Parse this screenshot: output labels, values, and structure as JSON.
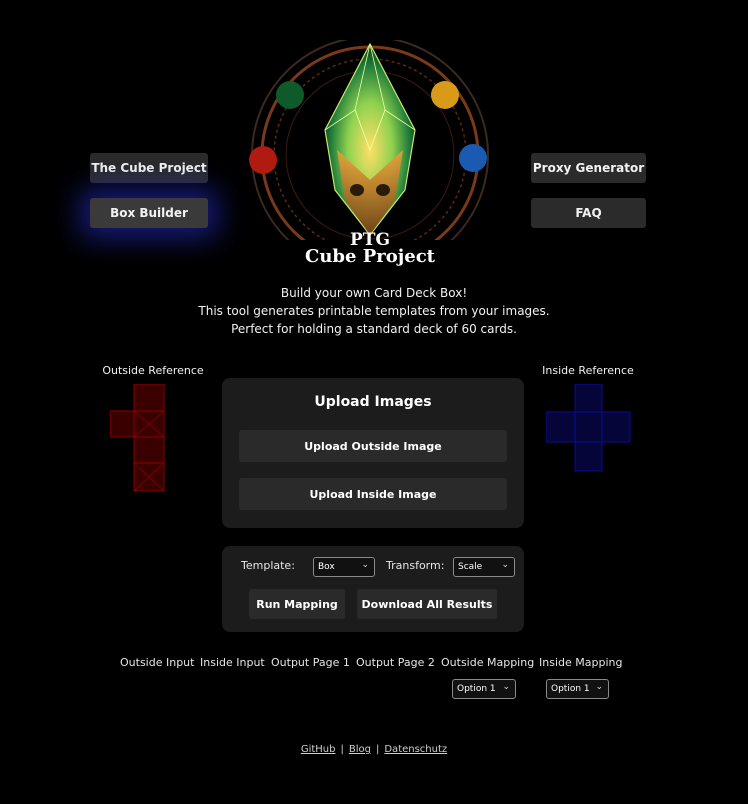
{
  "nav": {
    "cube_project": "The Cube Project",
    "box_builder": "Box Builder",
    "proxy_generator": "Proxy Generator",
    "faq": "FAQ"
  },
  "logo": {
    "line1": "PTG",
    "line2": "Cube Project"
  },
  "intro": {
    "line1": "Build your own Card Deck Box!",
    "line2": "This tool generates printable templates from your images.",
    "line3": "Perfect for holding a standard deck of 60 cards."
  },
  "references": {
    "outside_label": "Outside Reference",
    "inside_label": "Inside Reference",
    "outside_color": "#8b0000",
    "inside_color": "#0a0a9a"
  },
  "upload": {
    "title": "Upload Images",
    "outside_button": "Upload Outside Image",
    "inside_button": "Upload Inside Image"
  },
  "controls": {
    "template_label": "Template:",
    "template_value": "Box",
    "transform_label": "Transform:",
    "transform_value": "Scale",
    "run_button": "Run Mapping",
    "download_button": "Download All Results"
  },
  "outputs": {
    "labels": [
      "Outside Input",
      "Inside Input",
      "Output Page 1",
      "Output Page 2",
      "Outside Mapping",
      "Inside Mapping"
    ],
    "outside_mapping_value": "Option 1",
    "inside_mapping_value": "Option 1"
  },
  "footer": {
    "github": "GitHub",
    "blog": "Blog",
    "datenschutz": "Datenschutz",
    "separator": "|"
  }
}
